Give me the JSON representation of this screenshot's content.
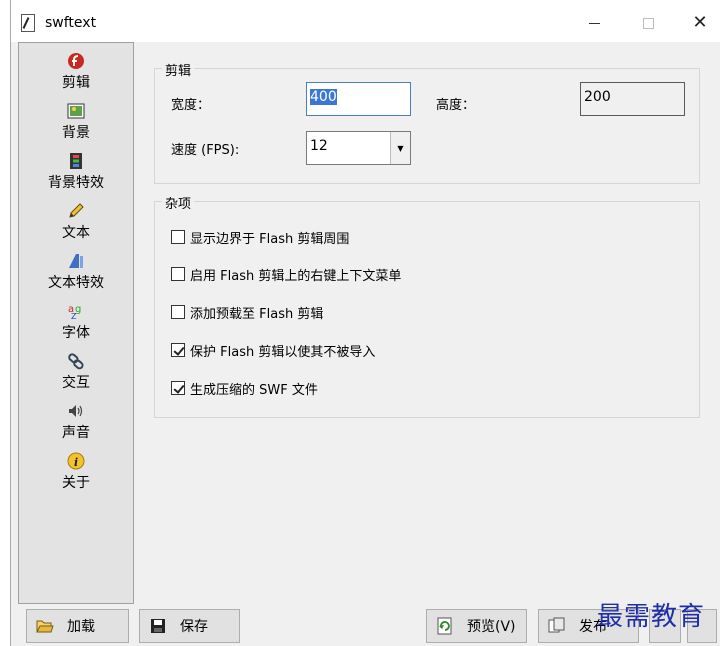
{
  "window": {
    "title": "swftext"
  },
  "sidebar": {
    "items": [
      {
        "label": "剪辑",
        "icon": "flash-icon"
      },
      {
        "label": "背景",
        "icon": "picture-icon"
      },
      {
        "label": "背景特效",
        "icon": "film-icon"
      },
      {
        "label": "文本",
        "icon": "pencil-icon"
      },
      {
        "label": "文本特效",
        "icon": "text-effect-icon"
      },
      {
        "label": "字体",
        "icon": "font-icon"
      },
      {
        "label": "交互",
        "icon": "link-icon"
      },
      {
        "label": "声音",
        "icon": "speaker-icon"
      },
      {
        "label": "关于",
        "icon": "info-icon"
      }
    ],
    "active": "剪辑"
  },
  "clip_group": {
    "title": "剪辑",
    "width_label": "宽度：",
    "width_value": "400",
    "height_label": "高度：",
    "height_value": "200",
    "fps_label": "速度 (FPS):",
    "fps_value": "12"
  },
  "misc_group": {
    "title": "杂项",
    "options": [
      {
        "label": "显示边界于 Flash 剪辑周围",
        "checked": false
      },
      {
        "label": "启用 Flash 剪辑上的右键上下文菜单",
        "checked": false
      },
      {
        "label": "添加预载至 Flash 剪辑",
        "checked": false
      },
      {
        "label": "保护 Flash 剪辑以使其不被导入",
        "checked": true
      },
      {
        "label": "生成压缩的 SWF 文件",
        "checked": true
      }
    ]
  },
  "bottom": {
    "load_label": "加载",
    "save_label": "保存",
    "preview_label": "预览(V)",
    "publish_label": "发布"
  },
  "watermark": "最需教育",
  "colors": {
    "selection": "#3a78d4",
    "watermark": "#1e2fa8",
    "focus_border": "#4a7fc1"
  }
}
